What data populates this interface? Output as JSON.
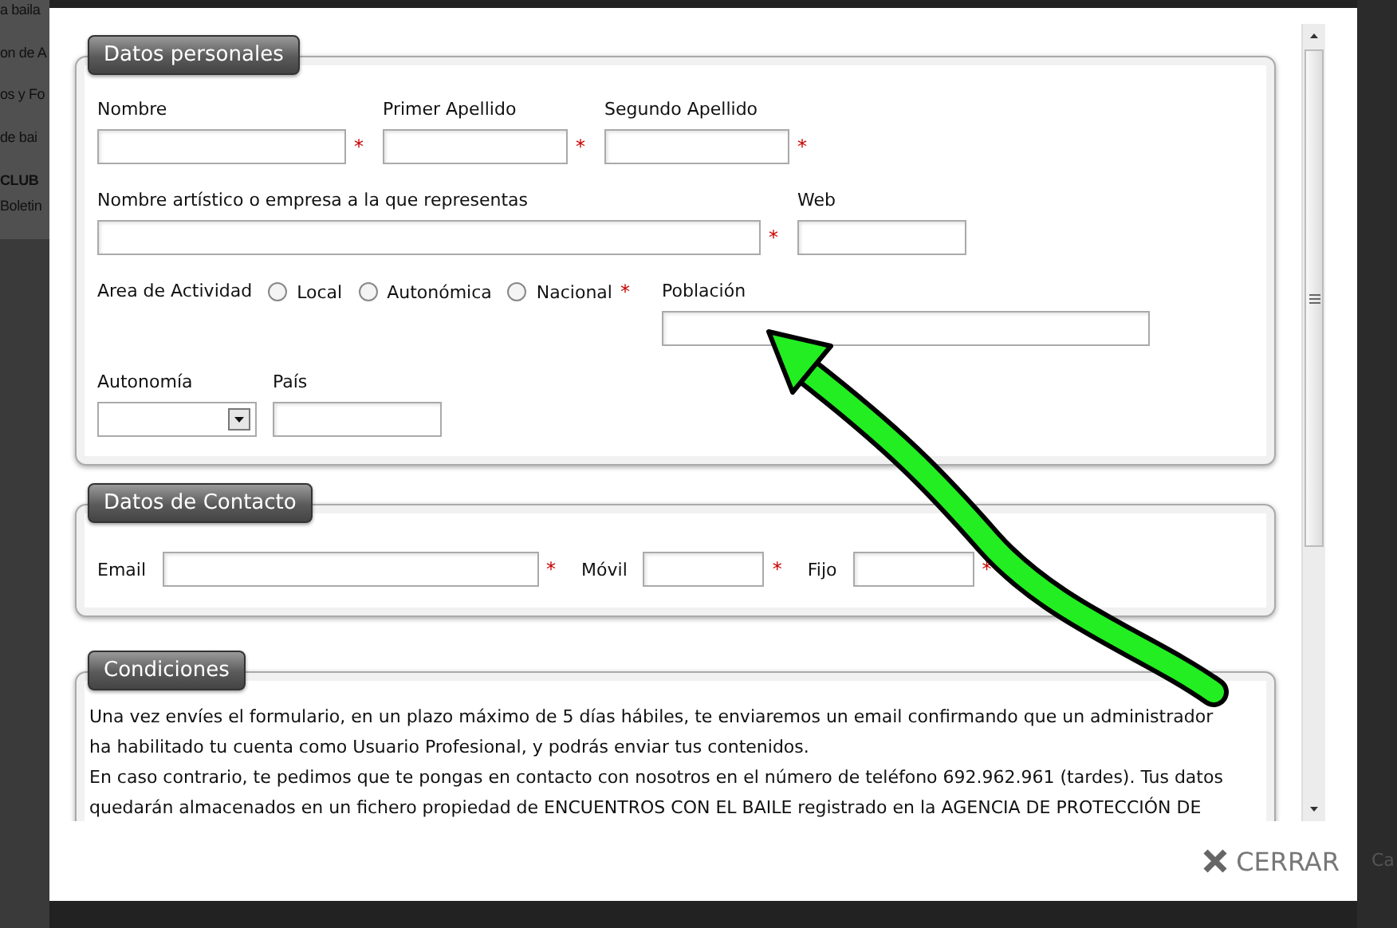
{
  "background_page": {
    "side_links": [
      "a baila",
      "on de A",
      "os y Fo",
      "de bai",
      "CLUB",
      "Boletin"
    ],
    "corner_link": "Ca"
  },
  "dialog": {
    "sections": [
      {
        "kind": "personal",
        "title": "Datos personales",
        "fields": [
          {
            "kind": "text",
            "label": "Nombre",
            "required_mark": "*"
          },
          {
            "kind": "text",
            "label": "Primer Apellido",
            "required_mark": "*"
          },
          {
            "kind": "text",
            "label": "Segundo Apellido",
            "required_mark": "*"
          },
          {
            "kind": "text",
            "label": "Nombre artístico o empresa a la que representas",
            "required_mark": "*"
          },
          {
            "kind": "text",
            "label": "Web"
          },
          {
            "kind": "radio",
            "label": "Area de Actividad",
            "required_mark": "*",
            "options": [
              {
                "label": "Local",
                "selected": false
              },
              {
                "label": "Autonómica",
                "selected": false
              },
              {
                "label": "Nacional",
                "selected": false
              }
            ]
          },
          {
            "kind": "text",
            "label": "Población"
          },
          {
            "kind": "select",
            "label": "Autonomía"
          },
          {
            "kind": "text",
            "label": "País"
          }
        ]
      },
      {
        "kind": "contact",
        "title": "Datos de Contacto",
        "fields": [
          {
            "kind": "inline",
            "label": "Email",
            "required_mark": "*"
          },
          {
            "kind": "inline",
            "label": "Móvil",
            "required_mark": "*"
          },
          {
            "kind": "inline",
            "label": "Fijo",
            "required_mark": "*"
          }
        ]
      },
      {
        "kind": "text",
        "title": "Condiciones",
        "paragraphs": [
          "Una vez envíes el formulario, en un plazo máximo de 5 días hábiles, te enviaremos un email confirmando que un administrador ha habilitado tu cuenta como Usuario Profesional, y podrás enviar tus contenidos.",
          "En caso contrario, te pedimos que te pongas en contacto con nosotros en el número de teléfono 692.962.961 (tardes). Tus datos quedarán almacenados en un fichero propiedad de ENCUENTROS CON EL BAILE registrado en la AGENCIA DE PROTECCIÓN DE"
        ]
      }
    ],
    "close_button": {
      "label": "CERRAR"
    }
  }
}
